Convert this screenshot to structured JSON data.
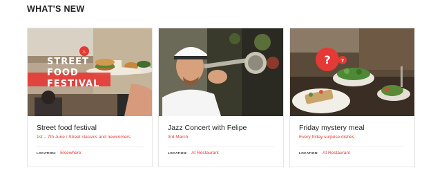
{
  "section": {
    "title": "WHAT'S NEW"
  },
  "colors": {
    "accent": "#e53935",
    "card_border": "#e6e6e6",
    "text": "#222222"
  },
  "cards": [
    {
      "title": "Street food festival",
      "subtitle": "1st – 7th June / Street classics and newcomers",
      "location_label": "LOCATION:",
      "location": "Elsewhere",
      "image_text": [
        "STREET",
        "FOOD",
        "FESTIVAL"
      ]
    },
    {
      "title": "Jazz Concert with Felipe",
      "subtitle": "3rd March",
      "location_label": "LOCATION:",
      "location": "At Restaurant"
    },
    {
      "title": "Friday mystery meal",
      "subtitle": "Every friday surprise dishes",
      "location_label": "LOCATION:",
      "location": "At Restaurant",
      "image_badge": "?"
    }
  ]
}
